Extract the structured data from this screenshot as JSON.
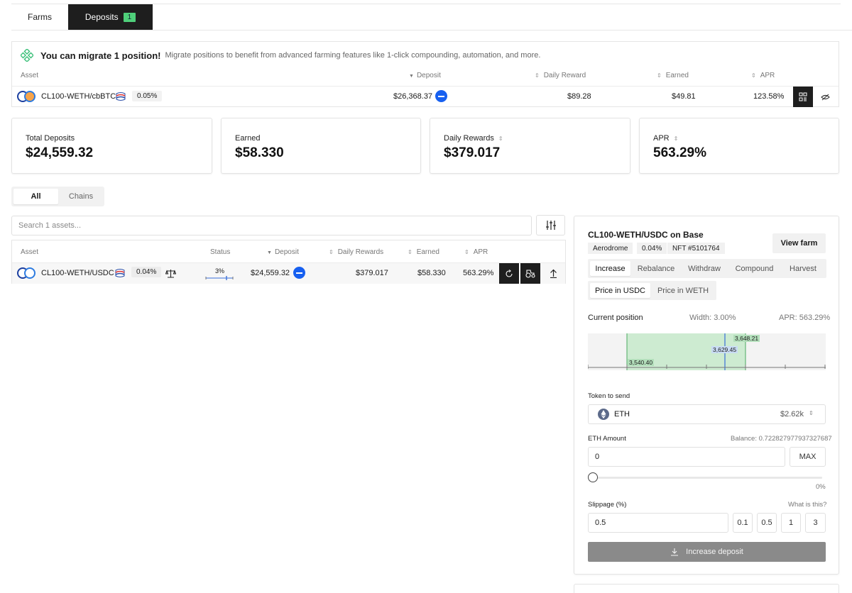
{
  "tabs": {
    "farms_label": "Farms",
    "deposits_label": "Deposits",
    "deposits_count": "1"
  },
  "migrate": {
    "title": "You can migrate 1 position!",
    "subtitle": "Migrate positions to benefit from advanced farming features like 1-click compounding, automation, and more.",
    "columns": {
      "asset": "Asset",
      "deposit": "Deposit",
      "daily_reward": "Daily Reward",
      "earned": "Earned",
      "apr": "APR"
    },
    "row": {
      "asset": "CL100-WETH/cbBTC",
      "fee": "0.05%",
      "deposit": "$26,368.37",
      "daily_reward": "$89.28",
      "earned": "$49.81",
      "apr": "123.58%"
    }
  },
  "stats": [
    {
      "label": "Total Deposits",
      "value": "$24,559.32"
    },
    {
      "label": "Earned",
      "value": "$58.330"
    },
    {
      "label": "Daily Rewards",
      "value": "$379.017"
    },
    {
      "label": "APR",
      "value": "563.29%"
    }
  ],
  "filter": {
    "all_label": "All",
    "chains_label": "Chains"
  },
  "search": {
    "placeholder": "Search 1 assets..."
  },
  "assets": {
    "columns": {
      "asset": "Asset",
      "status": "Status",
      "deposit": "Deposit",
      "daily_rewards": "Daily Rewards",
      "earned": "Earned",
      "apr": "APR"
    },
    "row": {
      "asset": "CL100-WETH/USDC",
      "fee": "0.04%",
      "status_pct": "3%",
      "deposit": "$24,559.32",
      "daily_rewards": "$379.017",
      "earned": "$58.330",
      "apr": "563.29%"
    }
  },
  "panel": {
    "title": "CL100-WETH/USDC on Base",
    "tags": [
      "Aerodrome",
      "0.04%",
      "NFT #5101764"
    ],
    "view_farm": "View farm",
    "actions": [
      "Increase",
      "Rebalance",
      "Withdraw",
      "Compound",
      "Harvest"
    ],
    "active_action": "Increase",
    "price_toggle": [
      "Price in USDC",
      "Price in WETH"
    ],
    "current_position": "Current position",
    "width": "Width: 3.00%",
    "apr": "APR: 563.29%",
    "range": {
      "lower": "3,540.40",
      "current": "3,629.45",
      "upper": "3,648.21"
    },
    "token_to_send_label": "Token to send",
    "token": "ETH",
    "token_price": "$2.62k",
    "amount_label": "ETH Amount",
    "balance": "Balance: 0.722827977937327687",
    "amount_value": "0",
    "max_label": "MAX",
    "slider_pct": "0%",
    "slider_value": 0,
    "slippage_label": "Slippage (%)",
    "what_is_this": "What is this?",
    "slippage_value": "0.5",
    "slippage_presets": [
      "0.1",
      "0.5",
      "1",
      "3"
    ],
    "submit_label": "Increase deposit"
  },
  "colors": {
    "accent_blue": "#1760f0",
    "badge_green": "#4fcf7a",
    "range_green": "#cdebd1",
    "dark": "#1e1e1e"
  }
}
